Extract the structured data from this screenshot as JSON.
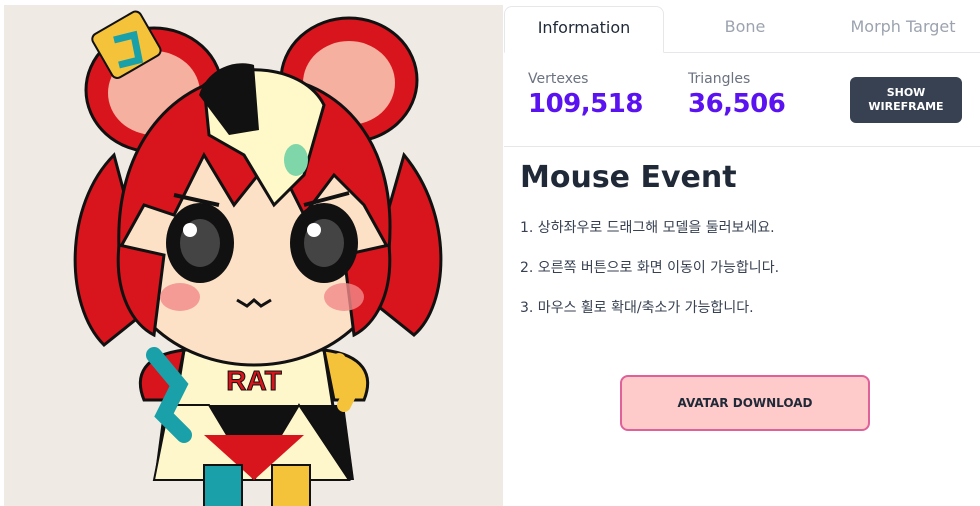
{
  "viewer": {
    "model_name": "mouse-girl avatar",
    "shirt_text": "RAT"
  },
  "tabs": [
    {
      "label": "Information",
      "active": true
    },
    {
      "label": "Bone",
      "active": false
    },
    {
      "label": "Morph Target",
      "active": false
    }
  ],
  "stats": {
    "vertexes_label": "Vertexes",
    "vertexes_value": "109,518",
    "triangles_label": "Triangles",
    "triangles_value": "36,506",
    "wireframe_button": "SHOW WIREFRAME"
  },
  "mouse_event": {
    "title": "Mouse Event",
    "tips": [
      "1. 상하좌우로 드래그해 모델을 둘러보세요.",
      "2. 오른쪽 버튼으로 화면 이동이 가능합니다.",
      "3. 마우스 휠로 확대/축소가 가능합니다."
    ]
  },
  "download_button": "AVATAR DOWNLOAD",
  "colors": {
    "accent": "#5b12f0",
    "dark_button": "#374151",
    "download_bg": "#fecaca",
    "download_border": "#e0609a",
    "viewer_bg": "#efebe4"
  }
}
